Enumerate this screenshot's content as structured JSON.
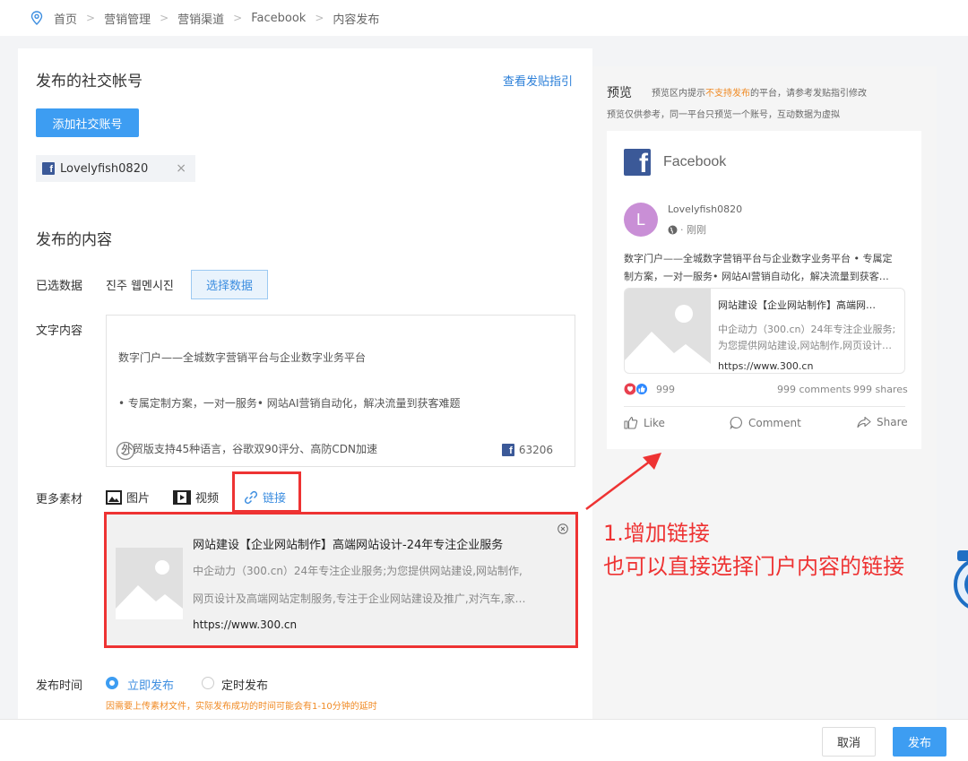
{
  "breadcrumb": [
    "首页",
    "营销管理",
    "营销渠道",
    "Facebook",
    "内容发布"
  ],
  "account_section": {
    "title": "发布的社交帐号",
    "guide_link": "查看发贴指引",
    "add_button": "添加社交账号",
    "selected_account": "Lovelyfish0820"
  },
  "content_section": {
    "title": "发布的内容",
    "selected_data_label": "已选数据",
    "selected_data_value": "진주 웹멘시진",
    "select_button": "选择数据",
    "text_label": "文字内容",
    "text_lines": [
      "数字门户——全城数字营销平台与企业数字业务平台",
      "• 专属定制方案，一对一服务• 网站AI营销自动化，解决流量到获客难题",
      " 外贸版支持45种语言，谷歌双90评分、高防CDN加速"
    ],
    "char_count": "63206",
    "more_label": "更多素材",
    "materials": [
      "图片",
      "视频",
      "链接"
    ]
  },
  "link_card": {
    "title": "网站建设【企业网站制作】高端网站设计-24年专注企业服务",
    "desc1": "中企动力（300.cn）24年专注企业服务;为您提供网站建设,网站制作,",
    "desc2": "网页设计及高端网站定制服务,专注于企业网站建设及推广,对汽车,家…",
    "url": "https://www.300.cn"
  },
  "publish_time": {
    "label": "发布时间",
    "option_now": "立即发布",
    "option_scheduled": "定时发布",
    "hint": "因需要上传素材文件，实际发布成功的时间可能会有1-10分钟的延时"
  },
  "footer": {
    "cancel": "取消",
    "publish": "发布"
  },
  "preview": {
    "title": "预览",
    "hint_prefix": "预览区内提示",
    "hint_highlight": "不支持发布",
    "hint_suffix": "的平台，请参考发贴指引修改",
    "hint_line2": "预览仅供参考，同一平台只预览一个账号，互动数据为虚拟",
    "platform": "Facebook",
    "avatar_letter": "L",
    "account_name": "Lovelyfish0820",
    "post_time": "· 刚刚",
    "post_text_line1": "数字门户——全城数字营销平台与企业数字业务平台 • 专属定",
    "post_text_line2": "制方案，一对一服务• 网站AI营销自动化，解决流量到获客…",
    "card_title": "网站建设【企业网站制作】高端网…",
    "card_desc1": "中企动力（300.cn）24年专注企业服务;",
    "card_desc2": "为您提供网站建设,网站制作,网页设计…",
    "card_url": "https://www.300.cn",
    "reactions_count": "999",
    "comments": "999 comments",
    "shares": "999 shares",
    "like": "Like",
    "comment": "Comment",
    "share": "Share"
  },
  "annotation": {
    "line1": "1.增加链接",
    "line2": "也可以直接选择门户内容的链接"
  },
  "colors": {
    "accent": "#3d9df2",
    "annotation_red": "#e33333",
    "facebook_blue": "#3b5998",
    "warning_orange": "#f08a24"
  }
}
